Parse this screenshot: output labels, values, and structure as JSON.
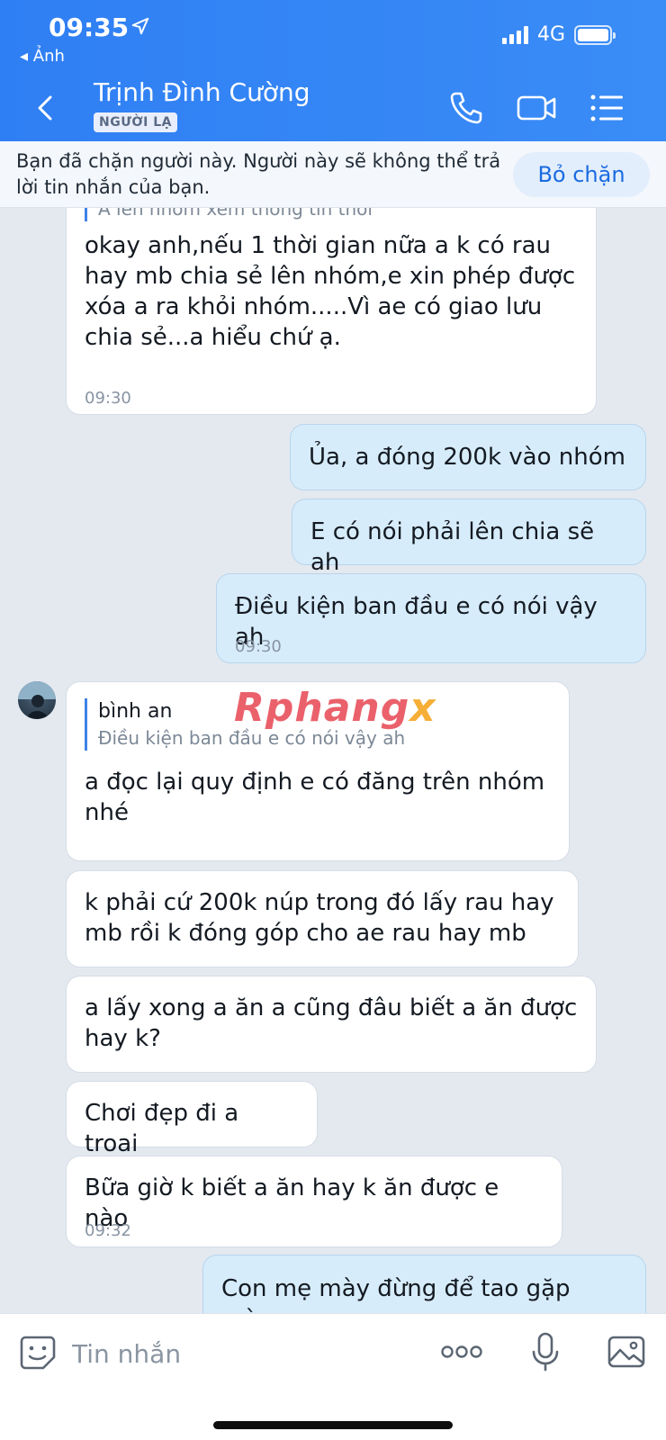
{
  "status_bar": {
    "time": "09:35",
    "back_app": "◂ Ảnh",
    "network": "4G"
  },
  "header": {
    "contact_name": "Trịnh Đình Cường",
    "badge": "NGƯỜI LẠ"
  },
  "blocked_banner": {
    "text": "Bạn đã chặn người này. Người này sẽ không thể trả lời tin nhắn của bạn.",
    "button": "Bỏ chặn"
  },
  "messages": [
    {
      "cut_quote": "A lên nhóm xem thông tin thôi",
      "text": "okay anh,nếu 1 thời gian nữa a k có rau hay mb chia sẻ lên nhóm,e xin phép được xóa a ra khỏi nhóm.....Vì ae có giao lưu chia sẻ...a hiểu chứ ạ.",
      "time": "09:30"
    },
    {
      "text": "Ủa, a đóng 200k vào nhóm"
    },
    {
      "text": "E có nói phải lên chia sẽ ah"
    },
    {
      "text": "Điều kiện ban đầu e có nói vậy ah",
      "time": "09:30"
    },
    {
      "quote_name": "bình an",
      "quote_text": "Điều kiện ban đầu e có nói vậy ah",
      "text": "a đọc lại quy định e có đăng trên nhóm nhé"
    },
    {
      "text": "k phải cứ 200k núp trong đó lấy rau hay mb rồi k đóng góp cho ae rau hay mb"
    },
    {
      "text": "a lấy xong a ăn a cũng đâu biết a ăn được hay k?"
    },
    {
      "text": "Chơi đẹp đi a troai"
    },
    {
      "text": "Bữa giờ k biết a ăn hay k ăn được e nào",
      "time": "09:32"
    },
    {
      "text": "Con mẹ mày đừng để tao gặp mày"
    }
  ],
  "watermark": {
    "main": "Rphang",
    "accent": "x"
  },
  "input": {
    "placeholder": "Tin nhắn"
  },
  "colors": {
    "header": "#2f7ff4",
    "outgoing": "#d7ecfb",
    "incoming": "#ffffff",
    "accent": "#1a6be0"
  }
}
